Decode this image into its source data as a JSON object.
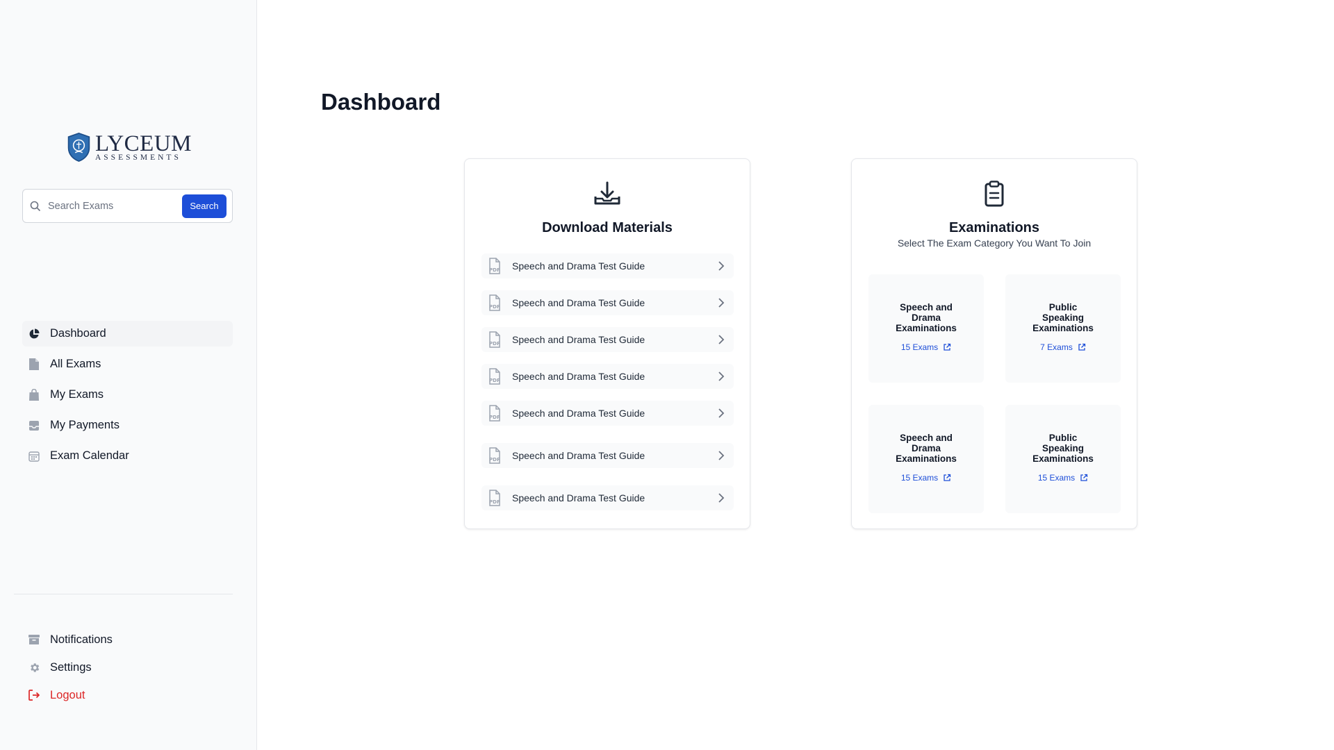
{
  "brand": {
    "name": "LYCEUM",
    "subtitle": "ASSESSMENTS"
  },
  "search": {
    "placeholder": "Search Exams",
    "button_label": "Search"
  },
  "nav": {
    "items": [
      {
        "label": "Dashboard",
        "icon": "pie-chart-icon",
        "active": true
      },
      {
        "label": "All Exams",
        "icon": "document-icon"
      },
      {
        "label": "My Exams",
        "icon": "shopping-bag-icon"
      },
      {
        "label": "My Payments",
        "icon": "inbox-icon"
      },
      {
        "label": "Exam Calendar",
        "icon": "calendar-icon"
      }
    ],
    "bottom": [
      {
        "label": "Notifications",
        "icon": "archive-box-icon"
      },
      {
        "label": "Settings",
        "icon": "gear-icon"
      },
      {
        "label": "Logout",
        "icon": "logout-icon",
        "color": "#dc2626"
      }
    ]
  },
  "page": {
    "title": "Dashboard"
  },
  "download": {
    "title": "Download Materials",
    "icon": "download-tray-icon",
    "items": [
      "Speech and Drama Test Guide",
      "Speech and Drama Test Guide",
      "Speech and Drama Test Guide",
      "Speech and Drama Test Guide",
      "Speech and Drama Test Guide",
      "Speech and Drama Test Guide",
      "Speech and Drama Test Guide"
    ]
  },
  "exams": {
    "title": "Examinations",
    "icon": "clipboard-icon",
    "subtitle": "Select The Exam Category You Want To Join",
    "categories": [
      {
        "line1": "Speech and",
        "line2": "Drama",
        "line3": "Examinations",
        "link": "15 Exams"
      },
      {
        "line1": "Public",
        "line2": "Speaking",
        "line3": "Examinations",
        "link": "7 Exams"
      },
      {
        "line1": "Speech and",
        "line2": "Drama",
        "line3": "Examinations",
        "link": "15 Exams"
      },
      {
        "line1": "Public",
        "line2": "Speaking",
        "line3": "Examinations",
        "link": "15 Exams"
      }
    ]
  },
  "colors": {
    "accent": "#1d4ed8",
    "danger": "#dc2626",
    "sidebar_bg": "#f9fafb"
  }
}
